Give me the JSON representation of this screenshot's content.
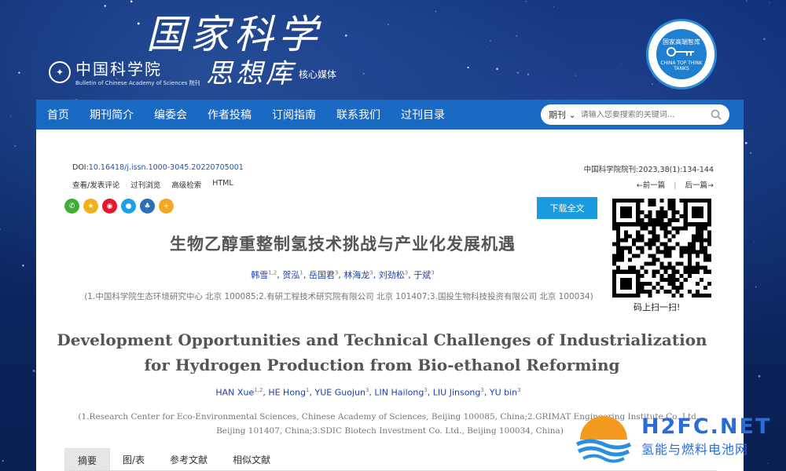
{
  "header": {
    "cas_logo_cn": "中国科学院",
    "cas_logo_en": "Bulletin of Chinese Academy of Sciences",
    "cas_logo_tag": "院刊",
    "brand_title": "国家科学",
    "brand_sub": "思想库",
    "brand_tag": "核心媒体",
    "think_tank_text": "CHINA TOP THINK TANKS",
    "think_tank_cn": "国家高端智库"
  },
  "nav": {
    "items": [
      "首页",
      "期刊简介",
      "编委会",
      "作者投稿",
      "订阅指南",
      "联系我们",
      "过刊目录"
    ],
    "search_select": "期刊",
    "search_placeholder": "请输入您要搜索的关键词..."
  },
  "article": {
    "doi_label": "DOI:",
    "doi_value": "10.16418/j.issn.1000-3045.20220705001",
    "citation": "中国科学院院刊:2023,38(1):134-144",
    "tools": [
      "查看/发表评论",
      "过刊浏览",
      "高级检索",
      "HTML"
    ],
    "prev_label": "←前一篇",
    "next_label": "后一篇→",
    "download_label": "下载全文",
    "qr_caption": "码上扫一扫!",
    "title_cn": "生物乙醇重整制氢技术挑战与产业化发展机遇",
    "authors_cn": [
      {
        "name": "韩雪",
        "sup": "1,2"
      },
      {
        "name": "贺泓",
        "sup": "1"
      },
      {
        "name": "岳国君",
        "sup": "3"
      },
      {
        "name": "林海龙",
        "sup": "3"
      },
      {
        "name": "刘劲松",
        "sup": "3"
      },
      {
        "name": "于斌",
        "sup": "3"
      }
    ],
    "affil_cn": "(1.中国科学院生态环境研究中心 北京 100085;2.有研工程技术研究院有限公司 北京 101407;3.国投生物科技投资有限公司 北京 100034)",
    "title_en": "Development Opportunities and Technical Challenges of Industrialization for Hydrogen Production from Bio-ethanol Reforming",
    "authors_en": [
      {
        "name": "HAN Xue",
        "sup": "1,2"
      },
      {
        "name": "HE Hong",
        "sup": "1"
      },
      {
        "name": "YUE Guojun",
        "sup": "3"
      },
      {
        "name": "LIN Hailong",
        "sup": "3"
      },
      {
        "name": "LIU Jinsong",
        "sup": "3"
      },
      {
        "name": "YU bin",
        "sup": "3"
      }
    ],
    "affil_en": "(1.Research Center for Eco-Environmental Sciences, Chinese Academy of Sciences, Beijing 100085, China;2.GRIMAT Engineering Institute Co. Ltd., Beijing 101407, China;3.SDIC Biotech Investment Co. Ltd., Beijing 100034, China)",
    "tabs": [
      "摘要",
      "图/表",
      "参考文献",
      "相似文献"
    ],
    "active_tab": "摘要"
  },
  "share_icons": [
    {
      "name": "wechat-icon",
      "color": "#3cb035",
      "glyph": "✆"
    },
    {
      "name": "qzone-icon",
      "color": "#f2b01e",
      "glyph": "★"
    },
    {
      "name": "weibo-icon",
      "color": "#e6162d",
      "glyph": "◉"
    },
    {
      "name": "qq-icon",
      "color": "#1ea0e6",
      "glyph": "●"
    },
    {
      "name": "renren-icon",
      "color": "#2a6fb8",
      "glyph": "♣"
    },
    {
      "name": "more-share-icon",
      "color": "#f5a623",
      "glyph": "+"
    }
  ],
  "watermark": {
    "brand_en": "H2FC.NET",
    "brand_cn": "氢能与燃料电池网"
  },
  "colors": {
    "nav_bg": "#1a69c2",
    "download_bg": "#1a9be0",
    "link": "#1a56b4"
  }
}
